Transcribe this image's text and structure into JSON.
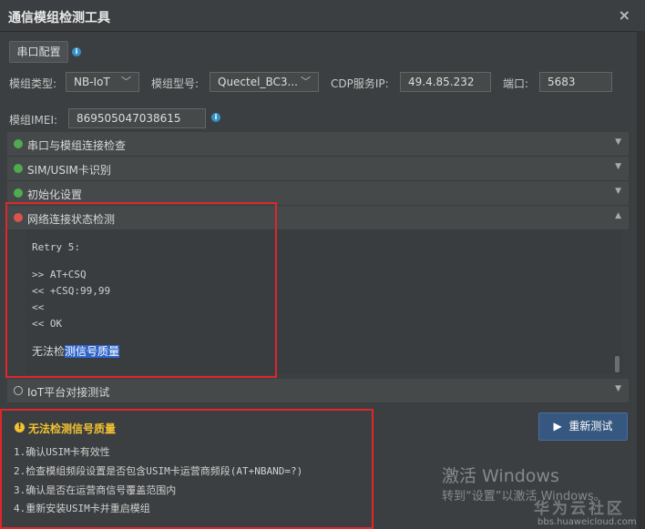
{
  "window": {
    "title": "通信模组检测工具",
    "close_glyph": "×"
  },
  "serial_config": {
    "label": "串口配置"
  },
  "form": {
    "module_type_label": "模组类型:",
    "module_type_value": "NB-IoT",
    "module_model_label": "模组型号:",
    "module_model_value": "Quectel_BC3...",
    "cdp_ip_label": "CDP服务IP:",
    "cdp_ip_value": "49.4.85.232",
    "port_label": "端口:",
    "port_value": "5683",
    "imei_label": "模组IMEI:",
    "imei_value": "869505047038615"
  },
  "checks": [
    {
      "label": "串口与模组连接检查",
      "status": "ok",
      "expanded": false
    },
    {
      "label": "SIM/USIM卡识别",
      "status": "ok",
      "expanded": false
    },
    {
      "label": "初始化设置",
      "status": "ok",
      "expanded": false
    },
    {
      "label": "网络连接状态检测",
      "status": "error",
      "expanded": true
    },
    {
      "label": "IoT平台对接测试",
      "status": "pending",
      "expanded": false
    }
  ],
  "console": {
    "retry": "Retry 5:",
    "lines": [
      ">> AT+CSQ",
      "<< +CSQ:99,99",
      "<<",
      "<< OK"
    ],
    "message_prefix": "无法检",
    "message_highlight": "测信号质量"
  },
  "result": {
    "title": "无法检测信号质量",
    "tips": [
      "1.确认USIM卡有效性",
      "2.检查模组频段设置是否包含USIM卡运营商频段(AT+NBAND=?)",
      "3.确认是否在运营商信号覆盖范围内",
      "4.重新安装USIM卡并重启模组"
    ]
  },
  "retest_button": {
    "label": "重新测试"
  },
  "watermark": {
    "activate": "激活 Windows",
    "activate_hint": "转到“设置”以激活 Windows。",
    "community": "华为云社区",
    "url": "bbs.huaweicloud.com"
  },
  "colors": {
    "ok": "#4fab4f",
    "error": "#d9534f",
    "warning": "#f2c230",
    "highlight_box": "#e0262b",
    "accent": "#365880"
  }
}
